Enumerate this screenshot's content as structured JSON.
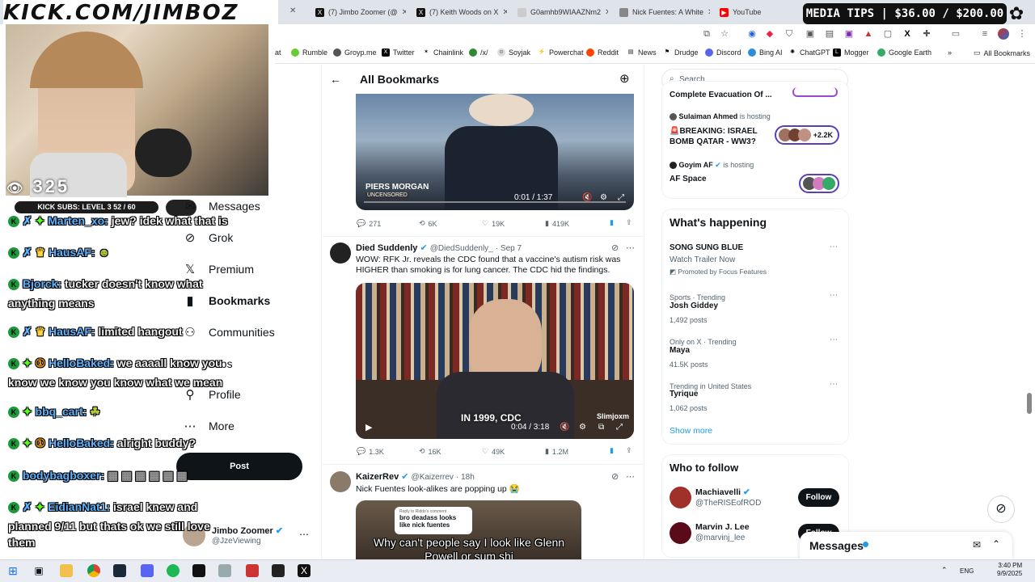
{
  "browser": {
    "tabs": [
      {
        "label": "(7) Jimbo Zoomer (@",
        "icon": "x-icon"
      },
      {
        "label": "(7) Keith Woods on X",
        "icon": "x-icon"
      },
      {
        "label": "G0amhb9WIAAZNm2",
        "icon": "image-icon"
      },
      {
        "label": "Nick Fuentes: A White",
        "icon": "globe-icon"
      },
      {
        "label": "YouTube",
        "icon": "youtube-icon"
      }
    ],
    "bookmarks": [
      "Rumble",
      "Groyp.me",
      "Twitter",
      "Chainlink",
      "/x/",
      "Soyjak",
      "Powerchat",
      "Reddit",
      "News",
      "Drudge",
      "Discord",
      "Bing AI",
      "ChatGPT",
      "Mogger",
      "Google Earth"
    ],
    "all_bookmarks": "All Bookmarks",
    "bookmark_partial": "at"
  },
  "overlay": {
    "banner": "KICK.COM/JIMBOZ",
    "media_tips": "MEDIA TIPS | $36.00 / $200.00",
    "viewers": "325",
    "kick_subs": "KICK SUBS: LEVEL 3 52 / 60"
  },
  "chat": [
    {
      "user": "Marten_xo:",
      "msg": "jew? idek what that is"
    },
    {
      "user": "HausAF:",
      "msg": ""
    },
    {
      "user": "Bjorck:",
      "msg": "tucker doesn't know what"
    },
    {
      "user": "",
      "msg": "anything means"
    },
    {
      "user": "HausAF:",
      "msg": "limited hangout"
    },
    {
      "user": "HelloBaked:",
      "msg": "we aaaall know you"
    },
    {
      "user": "",
      "msg": "know we know you know what we mean"
    },
    {
      "user": "bbq_cart:",
      "msg": ""
    },
    {
      "user": "HelloBaked:",
      "msg": "alright buddy?"
    },
    {
      "user": "bodybagboxer:",
      "msg": ""
    },
    {
      "user": "EidianNat1:",
      "msg": "israel knew and"
    },
    {
      "user": "",
      "msg": "planned 9/11 but thats ok we still love"
    },
    {
      "user": "",
      "msg": "them"
    }
  ],
  "sidebar": {
    "items": [
      {
        "label": "Messages",
        "icon": "mail-icon"
      },
      {
        "label": "Grok",
        "icon": "grok-icon"
      },
      {
        "label": "Premium",
        "icon": "x-icon"
      },
      {
        "label": "Bookmarks",
        "icon": "bookmark-icon"
      },
      {
        "label": "Communities",
        "icon": "communities-icon"
      },
      {
        "label": "Jobs",
        "icon": "briefcase-icon"
      },
      {
        "label": "Profile",
        "icon": "person-icon"
      },
      {
        "label": "More",
        "icon": "more-icon"
      }
    ],
    "post": "Post",
    "account_name": "Jimbo Zoomer",
    "account_handle": "@JzeViewing"
  },
  "timeline": {
    "header": "All Bookmarks",
    "tweet1": {
      "video_time": "0:01 / 1:37",
      "video_brand": "PIERS MORGAN",
      "video_sub": "UNCENSORED",
      "replies": "271",
      "reposts": "6K",
      "likes": "19K",
      "views": "419K"
    },
    "tweet2": {
      "name": "Died Suddenly",
      "handle": "@DiedSuddenly_",
      "date": "· Sep 7",
      "text": "WOW: RFK Jr. reveals the CDC found that a vaccine's autism risk was HIGHER than smoking is for lung cancer. The CDC hid the findings.",
      "video_time": "0:04 / 3:18",
      "video_caption": "IN 1999, CDC",
      "video_tag": "Slimjoxm",
      "replies": "1.3K",
      "reposts": "16K",
      "likes": "49K",
      "views": "1.2M"
    },
    "tweet3": {
      "name": "KaizerRev",
      "handle": "@Kaizerrev",
      "date": "· 18h",
      "text": "Nick Fuentes look-alikes are popping up 😭",
      "reply_bubble_top": "Reply to Riddo's comment",
      "reply_bubble": "bro deadass looks like nick fuentes",
      "caption": "Why can't people say I look like Glenn Powell or sum shi"
    }
  },
  "right": {
    "search_placeholder": "Search",
    "spaces": [
      {
        "host": "",
        "title": "Complete Evacuation Of ..."
      },
      {
        "host": "Sulaiman Ahmed",
        "hosting": "is hosting",
        "title": "🚨BREAKING: ISRAEL BOMB QATAR - WW3?",
        "count": "+2.2K"
      },
      {
        "host": "Goyim AF",
        "hosting": "is hosting",
        "title": "AF Space"
      }
    ],
    "happening_title": "What's happening",
    "trends": [
      {
        "context": "",
        "title": "SONG SUNG BLUE",
        "sub": "Watch Trailer Now",
        "promo": "Promoted by Focus Features"
      },
      {
        "context": "Sports · Trending",
        "title": "Josh Giddey",
        "sub": "1,492 posts"
      },
      {
        "context": "Only on X · Trending",
        "title": "Maya",
        "sub": "41.5K posts"
      },
      {
        "context": "Trending in United States",
        "title": "Tyrique",
        "sub": "1,062 posts"
      }
    ],
    "show_more": "Show more",
    "who_title": "Who to follow",
    "follow": [
      {
        "name": "Machiavelli",
        "handle": "@TheRISEofROD",
        "button": "Follow"
      },
      {
        "name": "Marvin J. Lee",
        "handle": "@marvinj_lee",
        "button": "Follow"
      }
    ],
    "messages_bar": "Messages"
  },
  "taskbar": {
    "time": "3:40 PM",
    "date": "9/9/2025",
    "lang": "ENG"
  }
}
